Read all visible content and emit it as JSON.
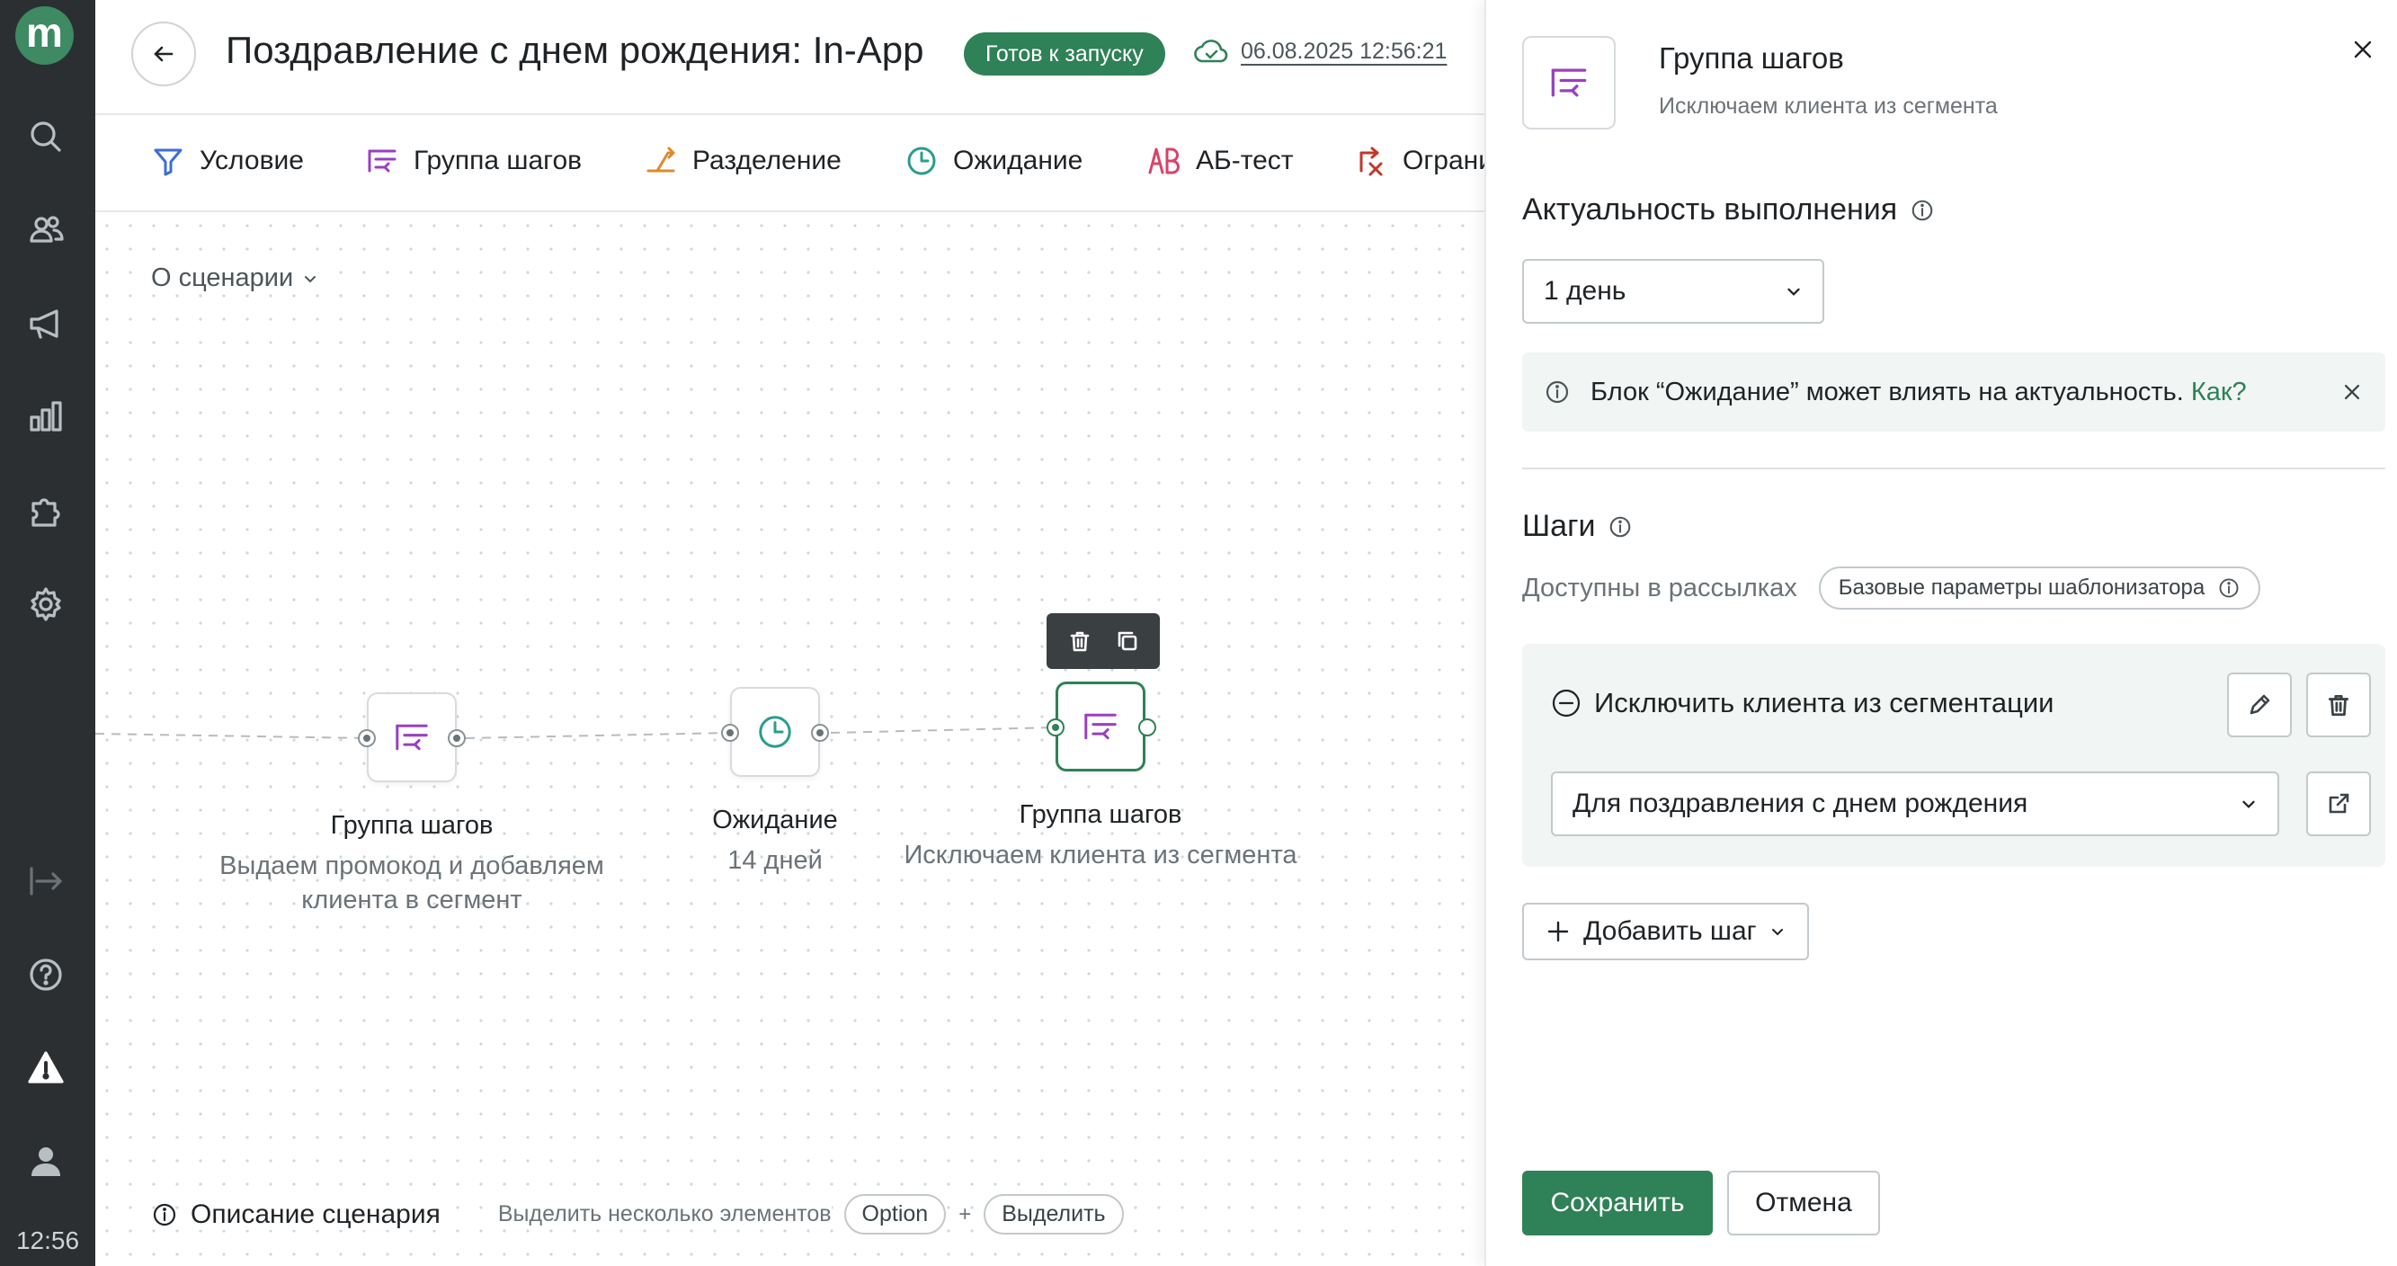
{
  "sidebar": {
    "logo": "m",
    "time": "12:56"
  },
  "header": {
    "title": "Поздравление с днем рождения: In-App",
    "status": "Готов к запуску",
    "saved_at": "06.08.2025 12:56:21"
  },
  "toolbar": {
    "items": [
      {
        "label": "Условие",
        "icon": "filter-icon"
      },
      {
        "label": "Группа шагов",
        "icon": "step-group-icon"
      },
      {
        "label": "Разделение",
        "icon": "split-icon"
      },
      {
        "label": "Ожидание",
        "icon": "clock-icon"
      },
      {
        "label": "АБ-тест",
        "icon": "ab-test-icon"
      },
      {
        "label": "Ограни",
        "icon": "limit-icon"
      }
    ]
  },
  "canvas": {
    "about_label": "О сценарии",
    "nodes": [
      {
        "title": "Группа шагов",
        "subtitle": "Выдаем промокод и добавляем клиента в сегмент"
      },
      {
        "title": "Ожидание",
        "subtitle": "14 дней"
      },
      {
        "title": "Группа шагов",
        "subtitle": "Исключаем клиента из сегмента"
      }
    ],
    "bottom": {
      "description_label": "Описание сценария",
      "hint": "Выделить несколько элементов",
      "key_option": "Option",
      "plus": "+",
      "key_select": "Выделить"
    }
  },
  "panel": {
    "title": "Группа шагов",
    "subtitle": "Исключаем клиента из сегмента",
    "relevance": {
      "heading": "Актуальность выполнения",
      "value": "1 день"
    },
    "notice": {
      "text": "Блок “Ожидание” может влиять на актуальность.",
      "link": "Как?"
    },
    "steps": {
      "heading": "Шаги",
      "available_label": "Доступны в рассылках",
      "chip": "Базовые параметры шаблонизатора",
      "step_title": "Исключить клиента из сегментации",
      "segment_value": "Для поздравления с днем рождения",
      "add_step": "Добавить шаг"
    },
    "save": "Сохранить",
    "cancel": "Отмена"
  },
  "colors": {
    "accent": "#2f8157",
    "sidebar_bg": "#2b2f31",
    "step_group_icon": "#9b3fc2",
    "split_icon": "#e0892b",
    "wait_icon": "#2a9d8f",
    "ab_icon": "#d8436a",
    "limit_icon": "#c0392b"
  }
}
